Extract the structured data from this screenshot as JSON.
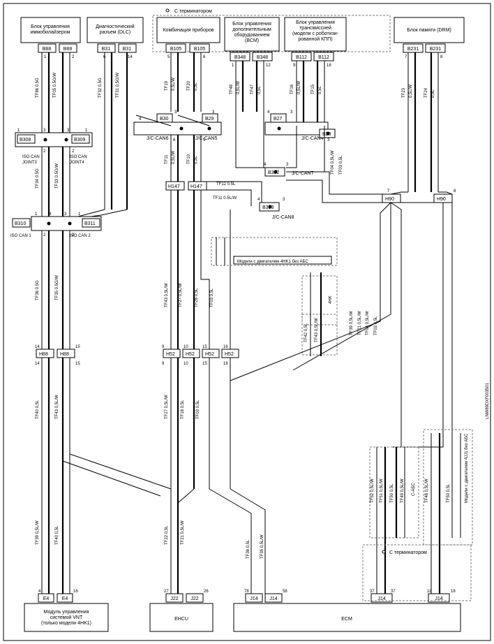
{
  "page_id": "LNW89DXF003501",
  "terminator_top": "С терминатором",
  "terminator_bottom": "С терминатором",
  "blocks": {
    "b1": "Блок управления\nиммобилайзером",
    "b2": "Диагностический\nразъем (DLC)",
    "b3": "Комбинация приборов",
    "b4": "Блок управления\nдополнительным\nоборудованием\n(BCM)",
    "b5": "Блок управления\nтрансмиссией\n(модели с роботизи-\nрованной КПП)",
    "b6": "Блок памяти (DRM)",
    "vnt": "Модуль управления\nсистемой VNT\n(только модели 4HK1)",
    "ehcu": "EHCU",
    "ecm": "ECM"
  },
  "connectors": {
    "B88a": "B88",
    "B88b": "B88",
    "B31a": "B31",
    "B31b": "B31",
    "B105a": "B105",
    "B105b": "B105",
    "B348a": "B348",
    "B348b": "B348",
    "B112a": "B112",
    "B112b": "B112",
    "B231a": "B231",
    "B231b": "B231",
    "B30": "B30",
    "B29": "B29",
    "B27": "B27",
    "B28": "B28",
    "B352": "B352",
    "B353": "B353",
    "B308": "B308",
    "B309": "B309",
    "B310": "B310",
    "B311": "B311",
    "H147a": "H147",
    "H147b": "H147",
    "H90a": "H90",
    "H90b": "H90",
    "H52a": "H52",
    "H52b": "H52",
    "H52c": "H52",
    "H52d": "H52",
    "H88a": "H88",
    "H88b": "H88",
    "E4a": "E4",
    "E4b": "E4",
    "J22a": "J22",
    "J22b": "J22",
    "J14a": "J14",
    "J14b": "J14",
    "J14c": "J14",
    "J14d": "J14"
  },
  "jc": {
    "jc5": "J/C-CAN5",
    "jc6": "J/C-CAN6",
    "jc7": "J/C-CAN7",
    "jc8": "J/C-CAN8",
    "jc4": "J/C-CAN4",
    "iso1": "ISO CAN\nJOINT3",
    "iso2": "ISO CAN\nJOINT4",
    "isoc1": "ISO CAN 1",
    "isoc2": "ISO CAN 2"
  },
  "notes": {
    "note4hk_noabs": "Модели с двигателем 4HK1 без АБС",
    "note4hk": "4HK",
    "note_cabs": "С-АБС",
    "note4jj_noabs": "Модели с двигателем 4JJ1 без АБС"
  },
  "wires": {
    "TF86": "TF86 0.5G",
    "TF05": "TF05 0.5G/W",
    "TF32": "TF32 0.5G",
    "TF31": "TF31 0.5G/W",
    "TF19": "TF19",
    "TF19s": "0.5L/W",
    "TF20": "TF20",
    "TF20s": "0,5L",
    "TF48": "TF48",
    "TF48s": "0,5L/W",
    "TF47": "TF47",
    "TF47s": "0,5L",
    "TF16": "TF16",
    "TF16s": "0,5L/W",
    "TF15": "TF15",
    "TF15s": "0,5L",
    "TF23": "TF23",
    "TF23s": "0,5L/W",
    "TF24": "TF24",
    "TF24s": "0,5L",
    "TF34": "TF34 0.5G",
    "TF33": "TF33 0.5G/W",
    "TF11": "TF11",
    "TF11s": "0,5L/W",
    "TF10": "TF10",
    "TF10s": "0,5L",
    "TF04": "TF04 0,5L/W",
    "TF03": "TF03 0,5L",
    "TF12b": "TF12 0.5L",
    "TF11b": "TF11 0.5L/W",
    "TF36": "TF36 0.5G",
    "TF35": "TF35 0.5G/W",
    "TF43l": "TF43 0,5L/W",
    "TF27": "TF27 0,5L/W",
    "TF28": "TF28 0,5L",
    "TF03l": "TF03 0,5L",
    "TF42": "TF42 0,5L",
    "TF43r": "TF43 0,5L/W",
    "TF39": "TF39 0,5L/W",
    "TF21l": "TF21 0,5L/W",
    "TF04l": "TF04 0,5L/W",
    "TF03b": "TF03 0,5L",
    "TF40": "TF40 0,5L",
    "TF43b": "TF43 0,5L/W",
    "TF27b": "TF27 0,5L/W",
    "TF18": "TF18 0,5L",
    "TF03c": "TF03 0,5L",
    "TF52": "TF52 0,5L/W",
    "TF51": "TF51 0,5L/W",
    "TF50": "TF50 0,5L",
    "TF49": "TF49 0,5L/W",
    "TF48b": "TF48 0,5L/W",
    "TF50b": "TF50 0,5L",
    "TF22": "TF22 0,5L",
    "TF21": "TF21 0,5L/W",
    "TF36b": "TF36 0,5L",
    "TF35b": "TF35 0,5L/W",
    "TF39b": "TF39 0,5L/W",
    "TF40b": "TF40 0,5L"
  }
}
